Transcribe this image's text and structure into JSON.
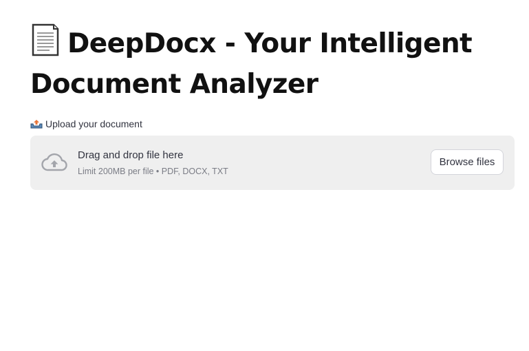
{
  "page": {
    "title": "DeepDocx - Your Intelligent Document Analyzer",
    "title_icon": "page-document-icon"
  },
  "uploader": {
    "label_icon": "outbox-tray-icon",
    "label": "Upload your document",
    "dropzone_icon": "cloud-upload-icon",
    "instructions": "Drag and drop file here",
    "limits": "Limit 200MB per file • PDF, DOCX, TXT",
    "browse_label": "Browse files"
  },
  "colors": {
    "dropzone_background": "#efefef",
    "text": "#31333f",
    "muted_text": "#7a7c85"
  }
}
